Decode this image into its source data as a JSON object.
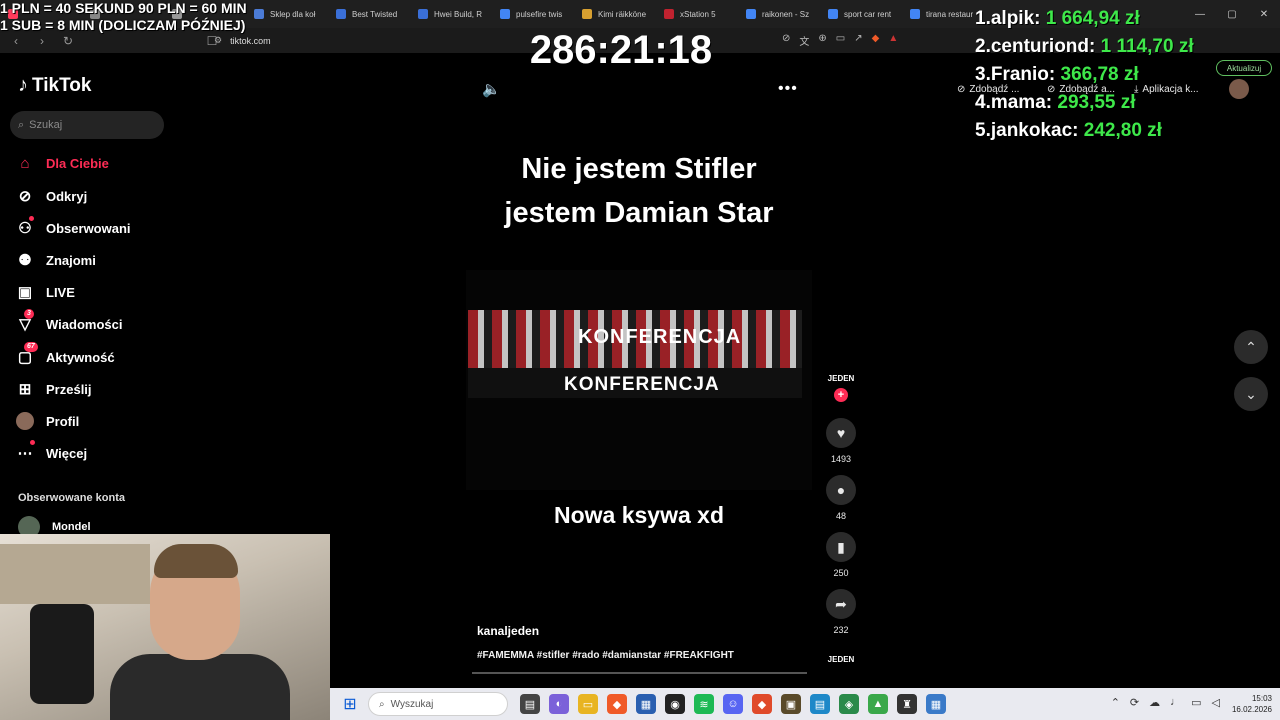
{
  "browser": {
    "tabs": [
      {
        "label": "",
        "color": "#ff3b5c"
      },
      {
        "label": "",
        "color": "#888888"
      },
      {
        "label": "",
        "color": "#999999"
      },
      {
        "label": "Sklep dla koł",
        "color": "#4b7bd6"
      },
      {
        "label": "Best Twisted",
        "color": "#3a6fd8"
      },
      {
        "label": "Hwei Build, R",
        "color": "#3a6fd8"
      },
      {
        "label": "pulsefire twis",
        "color": "#4285f4"
      },
      {
        "label": "Kimi räikköne",
        "color": "#d8a030"
      },
      {
        "label": "xStation 5",
        "color": "#c0222f"
      },
      {
        "label": "raikonen - Sz",
        "color": "#4285f4"
      },
      {
        "label": "sport car rent",
        "color": "#4285f4"
      },
      {
        "label": "tirana restaur",
        "color": "#4285f4"
      }
    ],
    "url": "tiktok.com",
    "bookmarks": {
      "b1": "Zdobądź ...",
      "b2": "Zdobądź a...",
      "b3": "Aplikacja k..."
    },
    "update_label": "Aktualizuj"
  },
  "overlay": {
    "line1": "1 PLN = 40 SEKUND 90 PLN = 60 MIN",
    "line2": "1 SUB = 8 MIN (DOLICZAM PÓŹNIEJ)",
    "timer": "286:21:18",
    "leaderboard": [
      {
        "name": "1.alpik:",
        "amount": "1 664,94 zł"
      },
      {
        "name": "2.centuriond:",
        "amount": "1 114,70 zł"
      },
      {
        "name": "3.Franio:",
        "amount": "366,78 zł"
      },
      {
        "name": "4.mama:",
        "amount": "293,55 zł"
      },
      {
        "name": "5.jankokac:",
        "amount": "242,80 zł"
      }
    ]
  },
  "tiktok": {
    "logo_text": "TikTok",
    "search_placeholder": "Szukaj",
    "nav": {
      "for_you": "Dla Ciebie",
      "explore": "Odkryj",
      "following": "Obserwowani",
      "friends": "Znajomi",
      "live": "LIVE",
      "messages": "Wiadomości",
      "messages_badge": "3",
      "activity": "Aktywność",
      "activity_badge": "67",
      "upload": "Prześlij",
      "profile": "Profil",
      "more": "Więcej"
    },
    "followed_title": "Obserwowane konta",
    "followed_account": "Mondel",
    "video": {
      "caption_line1": "Nie jestem Stifler",
      "caption_line2": "jestem Damian Star",
      "banner_text": "KONFERENCJA",
      "subtitle": "Nowa ksywa xd",
      "author": "kanaljeden",
      "hashtags": "#FAMEMMA #stifler #rado #damianstar #FREAKFIGHT",
      "creator_label": "JEDEN",
      "likes": "1493",
      "comments": "48",
      "saves": "250",
      "shares": "232"
    }
  },
  "taskbar": {
    "search_placeholder": "Wyszukaj",
    "time": "15:03",
    "date": "16.02.2026"
  }
}
